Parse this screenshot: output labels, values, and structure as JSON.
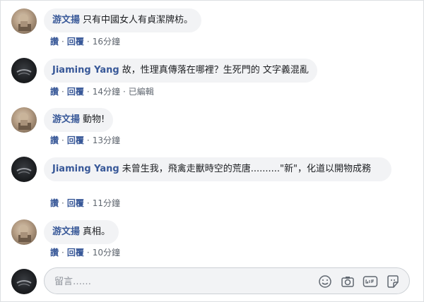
{
  "comments": [
    {
      "author": "游文揚",
      "text": "只有中國女人有貞潔牌枋。",
      "actions": [
        "讚",
        "回覆"
      ],
      "time": "16分鐘",
      "edited": ""
    },
    {
      "author": "Jiaming Yang",
      "text": "故，性理真傳落在哪裡？生死門的 文字義混亂",
      "actions": [
        "讚",
        "回覆"
      ],
      "time": "14分鐘",
      "edited": "已編輯"
    },
    {
      "author": "游文揚",
      "text": "動物!",
      "actions": [
        "讚",
        "回覆"
      ],
      "time": "13分鐘",
      "edited": ""
    },
    {
      "author": "Jiaming Yang",
      "text": "未曾生我，飛禽走獸時空的荒唐..........\"新\"，化道以開物成務",
      "actions": [
        "讚",
        "回覆"
      ],
      "time": "11分鐘",
      "edited": ""
    },
    {
      "author": "游文揚",
      "text": "真相。",
      "actions": [
        "讚",
        "回覆"
      ],
      "time": "10分鐘",
      "edited": ""
    }
  ],
  "composer": {
    "placeholder": "留言……",
    "icons": [
      "smiley-icon",
      "camera-icon",
      "gif-icon",
      "sticker-icon"
    ]
  }
}
